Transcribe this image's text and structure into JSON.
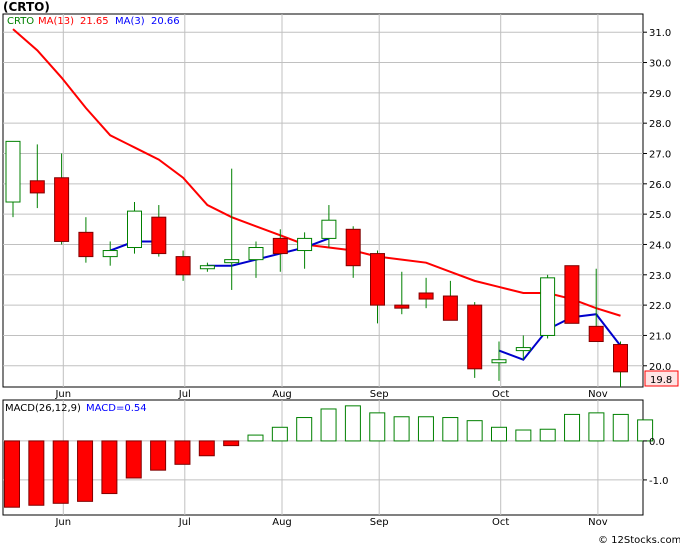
{
  "chart_data": [
    {
      "type": "candlestick",
      "title": "(CRTO)",
      "ticker": "CRTO",
      "legend": [
        {
          "label": "CRTO",
          "color": "#008000"
        },
        {
          "label": "MA(13)",
          "value": "21.65",
          "color": "#ff0000"
        },
        {
          "label": "MA(3)",
          "value": "20.66",
          "color": "#0000ff"
        }
      ],
      "colors": {
        "up": "#ffffff",
        "up_border": "#008000",
        "down": "#ff0000",
        "down_border": "#800000",
        "wick": "#008000",
        "ma13": "#ff0000",
        "ma3": "#0000cc",
        "grid": "#c0c0c0"
      },
      "ylim": [
        19.3,
        31.6
      ],
      "y_ticks": [
        20.0,
        21.0,
        22.0,
        23.0,
        24.0,
        25.0,
        26.0,
        27.0,
        28.0,
        29.0,
        30.0,
        31.0
      ],
      "y_tick_labels": [
        "20.0",
        "21.0",
        "22.0",
        "23.0",
        "24.0",
        "25.0",
        "26.0",
        "27.0",
        "28.0",
        "29.0",
        "30.0",
        "31.0"
      ],
      "last_price_label": "19.8",
      "last_price": 19.8,
      "x_labels": [
        {
          "label": "Jun",
          "index": 1
        },
        {
          "label": "Jul",
          "index": 6
        },
        {
          "label": "Aug",
          "index": 10
        },
        {
          "label": "Sep",
          "index": 14
        },
        {
          "label": "Oct",
          "index": 19
        },
        {
          "label": "Nov",
          "index": 23
        }
      ],
      "candles": [
        {
          "o": 25.4,
          "h": 26.1,
          "l": 24.9,
          "c": 27.4
        },
        {
          "o": 26.1,
          "h": 27.3,
          "l": 25.2,
          "c": 25.7
        },
        {
          "o": 26.2,
          "h": 27.0,
          "l": 24.0,
          "c": 24.1
        },
        {
          "o": 24.4,
          "h": 24.9,
          "l": 23.4,
          "c": 23.6
        },
        {
          "o": 23.6,
          "h": 24.1,
          "l": 23.3,
          "c": 23.8
        },
        {
          "o": 23.9,
          "h": 25.4,
          "l": 23.7,
          "c": 25.1
        },
        {
          "o": 24.9,
          "h": 25.3,
          "l": 23.6,
          "c": 23.7
        },
        {
          "o": 23.6,
          "h": 23.8,
          "l": 22.8,
          "c": 23.0
        },
        {
          "o": 23.2,
          "h": 23.4,
          "l": 23.1,
          "c": 23.3
        },
        {
          "o": 23.4,
          "h": 26.5,
          "l": 22.5,
          "c": 23.5
        },
        {
          "o": 23.5,
          "h": 24.1,
          "l": 22.9,
          "c": 23.9
        },
        {
          "o": 24.2,
          "h": 24.5,
          "l": 23.1,
          "c": 23.7
        },
        {
          "o": 23.8,
          "h": 24.4,
          "l": 23.2,
          "c": 24.2
        },
        {
          "o": 24.2,
          "h": 25.3,
          "l": 23.9,
          "c": 24.8
        },
        {
          "o": 24.5,
          "h": 24.6,
          "l": 22.9,
          "c": 23.3
        },
        {
          "o": 23.7,
          "h": 23.8,
          "l": 21.4,
          "c": 22.0
        },
        {
          "o": 22.0,
          "h": 23.1,
          "l": 21.7,
          "c": 21.9
        },
        {
          "o": 22.4,
          "h": 22.9,
          "l": 21.9,
          "c": 22.2
        },
        {
          "o": 22.3,
          "h": 22.8,
          "l": 21.5,
          "c": 21.5
        },
        {
          "o": 22.0,
          "h": 22.1,
          "l": 19.6,
          "c": 19.9
        },
        {
          "o": 20.1,
          "h": 20.8,
          "l": 19.5,
          "c": 20.2
        },
        {
          "o": 20.5,
          "h": 21.0,
          "l": 20.2,
          "c": 20.6
        },
        {
          "o": 21.0,
          "h": 23.0,
          "l": 20.9,
          "c": 22.9
        },
        {
          "o": 23.3,
          "h": 23.3,
          "l": 21.4,
          "c": 21.4
        },
        {
          "o": 21.3,
          "h": 23.2,
          "l": 20.8,
          "c": 20.8
        },
        {
          "o": 20.7,
          "h": 20.8,
          "l": 19.3,
          "c": 19.8
        }
      ],
      "ma13": [
        31.1,
        30.4,
        29.5,
        28.5,
        27.6,
        27.2,
        26.8,
        26.2,
        25.3,
        24.9,
        24.6,
        24.3,
        24.0,
        23.9,
        23.8,
        23.6,
        23.5,
        23.4,
        23.1,
        22.8,
        22.6,
        22.4,
        22.4,
        22.2,
        21.9,
        21.65
      ],
      "ma3": [
        null,
        null,
        null,
        null,
        23.8,
        24.1,
        24.1,
        null,
        23.3,
        23.3,
        23.5,
        23.7,
        23.9,
        24.2,
        null,
        null,
        null,
        null,
        null,
        null,
        20.5,
        20.2,
        21.2,
        21.6,
        21.7,
        20.66
      ]
    },
    {
      "type": "bar",
      "legend": [
        {
          "label": "MACD(26,12,9)",
          "color": "#000000"
        },
        {
          "label": "MACD=0.54",
          "color": "#0000ff"
        }
      ],
      "ylim": [
        -1.9,
        1.05
      ],
      "y_ticks": [
        0.0,
        -1.0
      ],
      "y_tick_labels": [
        "0.0",
        "-1.0"
      ],
      "values": [
        -1.7,
        -1.65,
        -1.6,
        -1.55,
        -1.35,
        -0.95,
        -0.75,
        -0.6,
        -0.38,
        -0.12,
        0.15,
        0.35,
        0.6,
        0.82,
        0.9,
        0.72,
        0.62,
        0.62,
        0.6,
        0.52,
        0.35,
        0.28,
        0.3,
        0.68,
        0.72,
        0.68,
        0.54
      ],
      "x_labels": [
        {
          "label": "Jun",
          "index": 1
        },
        {
          "label": "Jul",
          "index": 6
        },
        {
          "label": "Aug",
          "index": 10
        },
        {
          "label": "Sep",
          "index": 14
        },
        {
          "label": "Oct",
          "index": 19
        },
        {
          "label": "Nov",
          "index": 23
        }
      ]
    }
  ],
  "credit": "© 12Stocks.com"
}
